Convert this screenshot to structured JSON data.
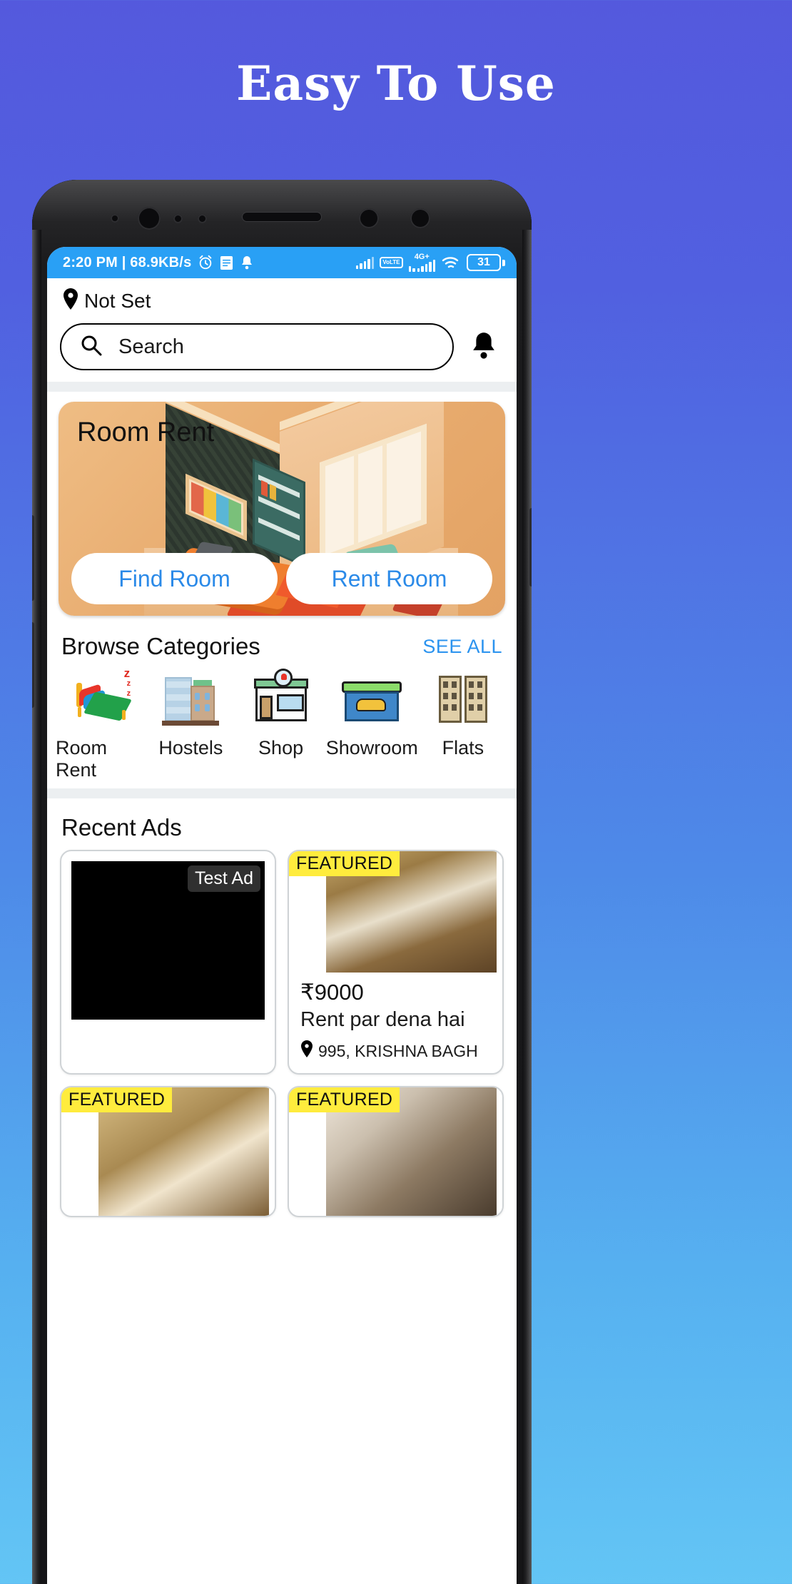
{
  "promo": {
    "headline": "Easy To Use"
  },
  "status_bar": {
    "time_and_speed": "2:20 PM | 68.9KB/s",
    "icons": [
      "alarm-icon",
      "list-icon",
      "bell-icon"
    ],
    "volte_label": "VoLTE",
    "network_label": "4G+",
    "battery_level": "31"
  },
  "app": {
    "location": {
      "icon": "location-pin-icon",
      "label": "Not Set"
    },
    "search": {
      "icon": "search-icon",
      "placeholder": "Search"
    },
    "notification": {
      "icon": "bell-icon"
    },
    "banner": {
      "title": "Room Rent",
      "buttons": [
        {
          "label": "Find Room"
        },
        {
          "label": "Rent Room"
        }
      ]
    },
    "categories_section": {
      "title": "Browse Categories",
      "see_all": "SEE ALL",
      "items": [
        {
          "label": "Room Rent",
          "icon": "bed-icon"
        },
        {
          "label": "Hostels",
          "icon": "buildings-icon"
        },
        {
          "label": "Shop",
          "icon": "storefront-icon"
        },
        {
          "label": "Showroom",
          "icon": "car-showroom-icon"
        },
        {
          "label": "Flats",
          "icon": "flats-icon"
        }
      ]
    },
    "recent_ads": {
      "title": "Recent Ads",
      "cards": [
        {
          "badge": "Test Ad",
          "badge_type": "test",
          "price": "",
          "description": "",
          "location": ""
        },
        {
          "badge": "FEATURED",
          "badge_type": "featured",
          "price": "₹9000",
          "description": "Rent par dena hai",
          "location": "995, KRISHNA BAGH"
        },
        {
          "badge": "FEATURED",
          "badge_type": "featured",
          "price": "",
          "description": "",
          "location": ""
        },
        {
          "badge": "FEATURED",
          "badge_type": "featured",
          "price": "",
          "description": "",
          "location": ""
        }
      ]
    }
  },
  "colors": {
    "page_top": "#5459dd",
    "page_bottom": "#63c5f5",
    "status_bar": "#29a0f5",
    "accent_blue": "#2b8ae8",
    "link_blue": "#2b93ef",
    "featured_yellow": "#ffec3d",
    "banner_tan": "#e9ae72"
  }
}
